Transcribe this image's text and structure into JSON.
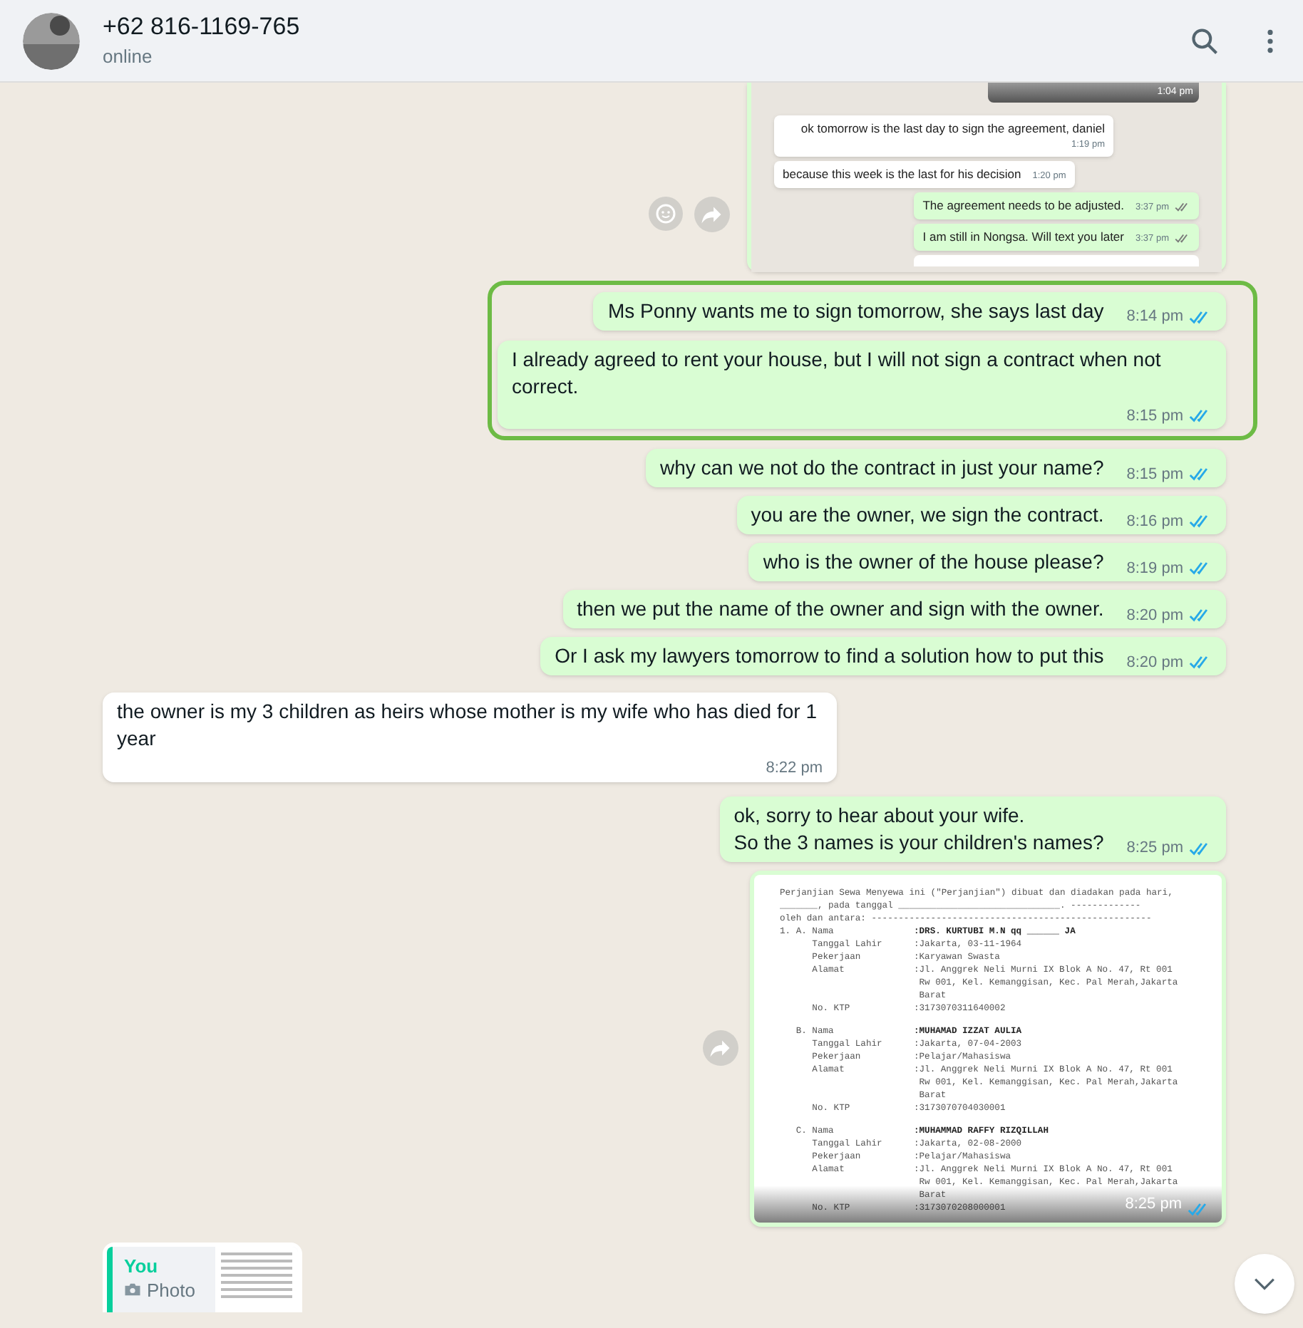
{
  "header": {
    "contact": "+62 816-1169-765",
    "status": "online"
  },
  "messages": [
    {
      "kind": "screenshot",
      "outgoing": true,
      "top_time": "1:04 pm",
      "items": [
        {
          "outgoing": false,
          "text": "ok tomorrow is the last day to sign the agreement, daniel",
          "time": "1:19 pm"
        },
        {
          "outgoing": false,
          "text": "because this week is the last for his decision",
          "time": "1:20 pm"
        },
        {
          "outgoing": true,
          "text": "The agreement needs to be adjusted.",
          "time": "3:37 pm",
          "read": false
        },
        {
          "outgoing": true,
          "text": "I am still in Nongsa. Will text you later",
          "time": "3:37 pm",
          "read": false
        }
      ]
    },
    {
      "kind": "highlight",
      "items": [
        {
          "outgoing": true,
          "text": "Ms Ponny wants me to sign tomorrow, she says last day",
          "time": "8:14 pm",
          "read": true
        },
        {
          "outgoing": true,
          "text": "I already agreed to rent your house, but I will not sign a contract when not correct.",
          "time": "8:15 pm",
          "read": true
        }
      ]
    },
    {
      "kind": "text",
      "outgoing": true,
      "text": "why can we not do the contract in just your name?",
      "time": "8:15 pm",
      "read": true
    },
    {
      "kind": "text",
      "outgoing": true,
      "text": "you are the owner, we sign the contract.",
      "time": "8:16 pm",
      "read": true
    },
    {
      "kind": "text",
      "outgoing": true,
      "text": "who is the owner of the house please?",
      "time": "8:19 pm",
      "read": true
    },
    {
      "kind": "text",
      "outgoing": true,
      "text": "then we put the name of the owner and sign with the owner.",
      "time": "8:20 pm",
      "read": true
    },
    {
      "kind": "text",
      "outgoing": true,
      "text": "Or I ask my lawyers tomorrow to find a solution how to put this",
      "time": "8:20 pm",
      "read": true
    },
    {
      "kind": "text",
      "outgoing": false,
      "text": "the owner is my 3 children as heirs whose mother is my wife who has died for 1 year",
      "time": "8:22 pm"
    },
    {
      "kind": "text",
      "outgoing": true,
      "text": "ok, sorry to hear about your wife.\nSo the 3 names is your children's names?",
      "time": "8:25 pm",
      "read": true
    },
    {
      "kind": "document",
      "outgoing": true,
      "time": "8:25 pm",
      "read": true,
      "intro": [
        "Perjanjian Sewa Menyewa ini (\"Perjanjian\") dibuat dan diadakan pada hari,",
        "_______, pada tanggal ______________________________. -------------",
        "oleh dan antara: ----------------------------------------------------"
      ],
      "sections": [
        {
          "rows": [
            {
              "label": "1. A. Nama",
              "lines": [
                ":DRS. KURTUBI M.N qq ______ JA"
              ],
              "bold": true
            },
            {
              "label": "      Tanggal Lahir",
              "lines": [
                ":Jakarta, 03-11-1964"
              ],
              "bold": false
            },
            {
              "label": "      Pekerjaan",
              "lines": [
                ":Karyawan Swasta"
              ],
              "bold": false
            },
            {
              "label": "      Alamat",
              "lines": [
                ":Jl. Anggrek Neli Murni IX Blok A No. 47, Rt 001",
                " Rw 001, Kel. Kemanggisan, Kec. Pal Merah,Jakarta",
                " Barat"
              ],
              "bold": false
            },
            {
              "label": "      No. KTP",
              "lines": [
                ":3173070311640002"
              ],
              "bold": false
            }
          ]
        },
        {
          "rows": [
            {
              "label": "   B. Nama",
              "lines": [
                ":MUHAMAD IZZAT AULIA"
              ],
              "bold": true
            },
            {
              "label": "      Tanggal Lahir",
              "lines": [
                ":Jakarta, 07-04-2003"
              ],
              "bold": false
            },
            {
              "label": "      Pekerjaan",
              "lines": [
                ":Pelajar/Mahasiswa"
              ],
              "bold": false
            },
            {
              "label": "      Alamat",
              "lines": [
                ":Jl. Anggrek Neli Murni IX Blok A No. 47, Rt 001",
                " Rw 001, Kel. Kemanggisan, Kec. Pal Merah,Jakarta",
                " Barat"
              ],
              "bold": false
            },
            {
              "label": "      No. KTP",
              "lines": [
                ":3173070704030001"
              ],
              "bold": false
            }
          ]
        },
        {
          "rows": [
            {
              "label": "   C. Nama",
              "lines": [
                ":MUHAMMAD RAFFY RIZQILLAH"
              ],
              "bold": true
            },
            {
              "label": "      Tanggal Lahir",
              "lines": [
                ":Jakarta, 02-08-2000"
              ],
              "bold": false
            },
            {
              "label": "      Pekerjaan",
              "lines": [
                ":Pelajar/Mahasiswa"
              ],
              "bold": false
            },
            {
              "label": "      Alamat",
              "lines": [
                ":Jl. Anggrek Neli Murni IX Blok A No. 47, Rt 001",
                " Rw 001, Kel. Kemanggisan, Kec. Pal Merah,Jakarta",
                " Barat"
              ],
              "bold": false
            },
            {
              "label": "      No. KTP",
              "lines": [
                ":3173070208000001"
              ],
              "bold": false
            }
          ]
        }
      ]
    },
    {
      "kind": "reply",
      "outgoing": false,
      "quote": {
        "author": "You",
        "media": "Photo"
      }
    }
  ]
}
